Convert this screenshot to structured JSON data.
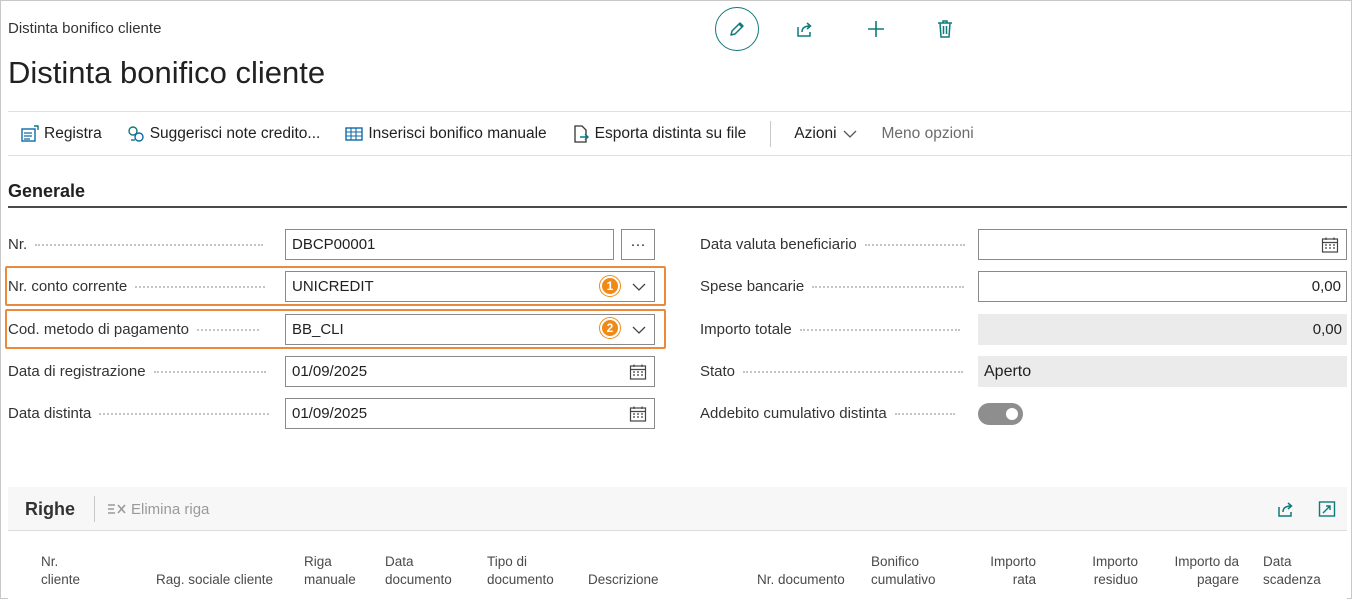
{
  "breadcrumb": "Distinta bonifico cliente",
  "title": "Distinta bonifico cliente",
  "top_actions": {
    "edit_icon": "pencil-icon",
    "share_icon": "share-icon",
    "new_icon": "plus-icon",
    "delete_icon": "trash-icon"
  },
  "actions": {
    "post": "Registra",
    "suggest": "Suggerisci note credito...",
    "insert_manual": "Inserisci bonifico manuale",
    "export": "Esporta distinta su file",
    "more": "Azioni",
    "fewer": "Meno opzioni"
  },
  "section": {
    "title": "Generale"
  },
  "fields_left": {
    "no_label": "Nr.",
    "no_value": "DBCP00001",
    "no_assist": "···",
    "account_label": "Nr. conto corrente",
    "account_value": "UNICREDIT",
    "account_badge": "1",
    "method_label": "Cod. metodo di pagamento",
    "method_value": "BB_CLI",
    "method_badge": "2",
    "posting_label": "Data di registrazione",
    "posting_value": "01/09/2025",
    "slip_label": "Data distinta",
    "slip_value": "01/09/2025"
  },
  "fields_right": {
    "value_date_label": "Data valuta beneficiario",
    "value_date_value": "",
    "fees_label": "Spese bancarie",
    "fees_value": "0,00",
    "total_label": "Importo totale",
    "total_value": "0,00",
    "status_label": "Stato",
    "status_value": "Aperto",
    "cumulative_label": "Addebito cumulativo distinta",
    "cumulative_on": true
  },
  "lines": {
    "title": "Righe",
    "delete_label": "Elimina riga",
    "columns": [
      "Nr.\ncliente",
      "Rag. sociale cliente",
      "Riga\nmanuale",
      "Data\ndocumento",
      "Tipo di\ndocumento",
      "Descrizione",
      "Nr. documento",
      "Bonifico\ncumulativo",
      "Importo\nrata",
      "Importo\nresiduo",
      "Importo da\npagare",
      "Data\nscadenza"
    ]
  },
  "colors": {
    "accent": "#0e7a7a",
    "highlight": "#ea8a3c",
    "badge": "#f08a17"
  }
}
